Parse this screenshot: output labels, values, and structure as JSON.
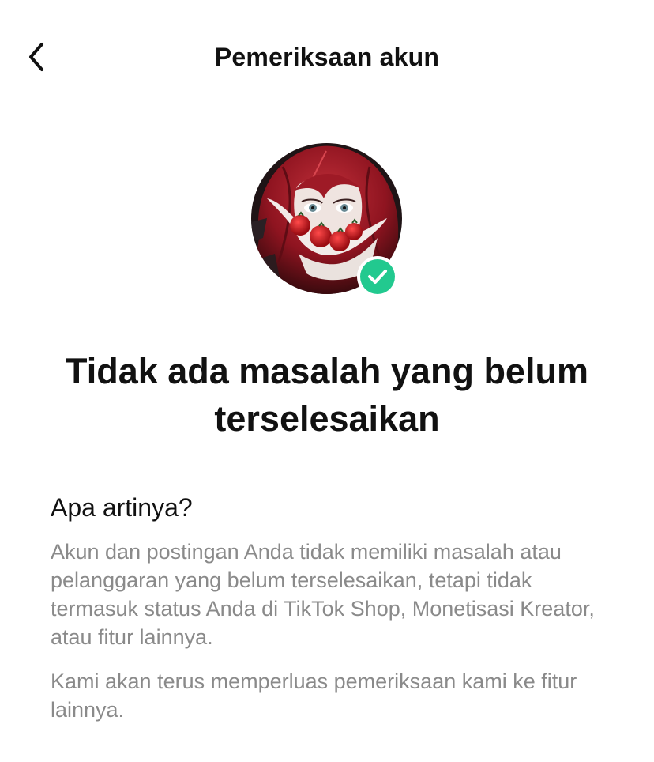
{
  "header": {
    "title": "Pemeriksaan akun",
    "back_icon": "chevron-left-icon"
  },
  "profile": {
    "avatar_icon": "profile-photo",
    "badge_icon": "verified-check-icon",
    "badge_color": "#22c98f"
  },
  "status": {
    "title": "Tidak ada masalah yang belum terselesaikan"
  },
  "info": {
    "heading": "Apa artinya?",
    "paragraph_1": "Akun dan postingan Anda tidak memiliki masalah atau pelanggaran yang belum terselesaikan, tetapi tidak termasuk status Anda di TikTok Shop, Monetisasi Kreator, atau fitur lainnya.",
    "paragraph_2": "Kami akan terus memperluas pemeriksaan kami ke fitur lainnya."
  },
  "colors": {
    "text_primary": "#111111",
    "text_secondary": "#8a8a8a",
    "background": "#ffffff"
  }
}
